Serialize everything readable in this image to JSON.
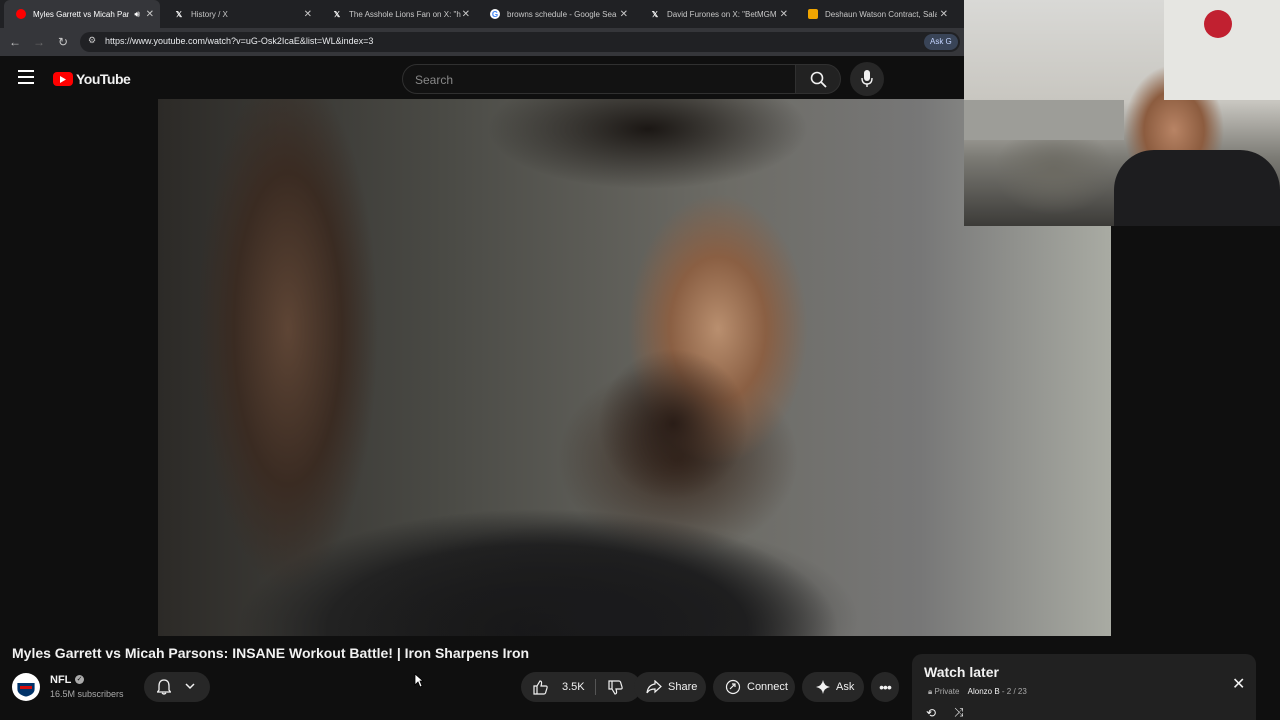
{
  "browser": {
    "tabs": [
      {
        "title": "Myles Garrett vs Micah Parsons",
        "favicon": "youtube-icon",
        "active": true
      },
      {
        "title": "History / X",
        "favicon": "x-icon"
      },
      {
        "title": "The Asshole Lions Fan on X: \"h",
        "favicon": "x-icon"
      },
      {
        "title": "browns schedule - Google Sea",
        "favicon": "google-icon"
      },
      {
        "title": "David Furones on X: \"BetMGM",
        "favicon": "x-icon"
      },
      {
        "title": "Deshaun Watson Contract, Sala",
        "favicon": "spotrac-icon"
      }
    ],
    "url": "https://www.youtube.com/watch?v=uG-Osk2IcaE&list=WL&index=3",
    "ask_label": "Ask G"
  },
  "youtube": {
    "logo_text": "YouTube",
    "search_placeholder": "Search"
  },
  "video": {
    "title": "Myles Garrett vs Micah Parsons: INSANE Workout Battle! | Iron Sharpens Iron",
    "channel": "NFL",
    "subscribers": "16.5M subscribers",
    "likes": "3.5K",
    "share_label": "Share",
    "connect_label": "Connect",
    "ask_label": "Ask"
  },
  "playlist": {
    "title": "Watch later",
    "privacy": "Private",
    "owner": "Alonzo B",
    "position": "2 / 23"
  },
  "colors": {
    "youtube_red": "#ff0000",
    "background": "#0f0f0f",
    "tab_bar": "#202124"
  }
}
